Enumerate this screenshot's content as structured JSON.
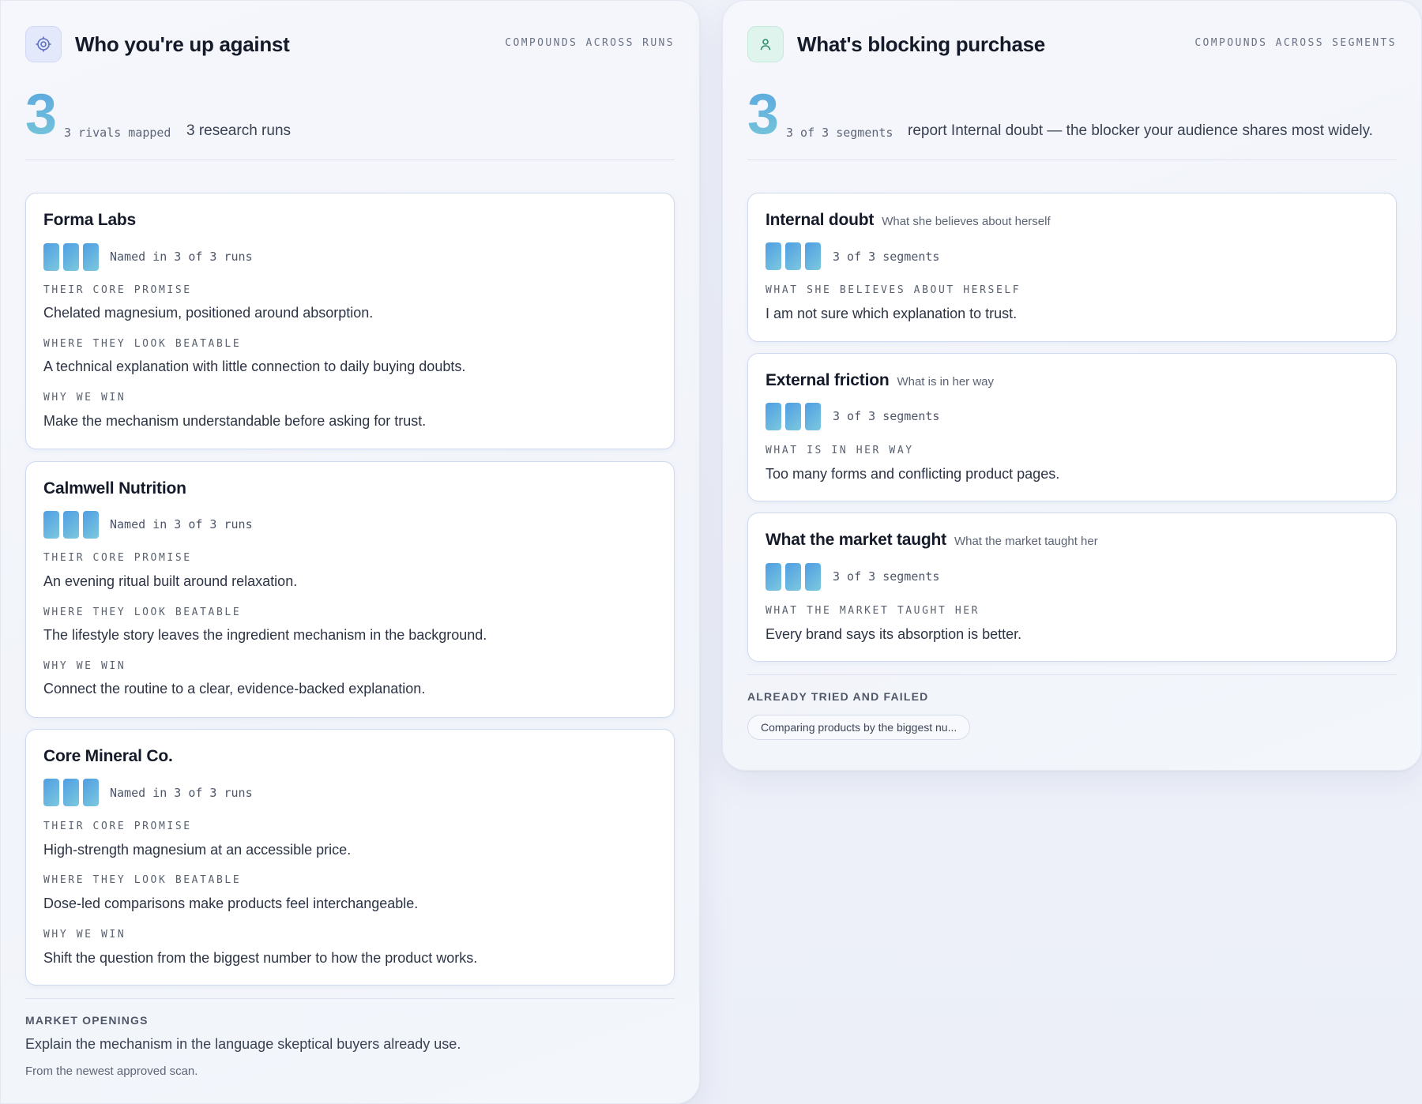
{
  "left": {
    "title": "Who you're up against",
    "tag": "COMPOUNDS ACROSS RUNS",
    "stat_number": "3",
    "stat_mono": "3 rivals mapped",
    "stat_text": "3 research runs",
    "icon": "target-icon",
    "rivals": [
      {
        "name": "Forma Labs",
        "runs_label": "Named in 3 of 3 runs",
        "runs_named": 3,
        "runs_total": 3,
        "promise_label": "THEIR CORE PROMISE",
        "promise": "Chelated magnesium, positioned around absorption.",
        "beatable_label": "WHERE THEY LOOK BEATABLE",
        "beatable": "A technical explanation with little connection to daily buying doubts.",
        "win_label": "WHY WE WIN",
        "win": "Make the mechanism understandable before asking for trust."
      },
      {
        "name": "Calmwell Nutrition",
        "runs_label": "Named in 3 of 3 runs",
        "runs_named": 3,
        "runs_total": 3,
        "promise_label": "THEIR CORE PROMISE",
        "promise": "An evening ritual built around relaxation.",
        "beatable_label": "WHERE THEY LOOK BEATABLE",
        "beatable": "The lifestyle story leaves the ingredient mechanism in the background.",
        "win_label": "WHY WE WIN",
        "win": "Connect the routine to a clear, evidence-backed explanation."
      },
      {
        "name": "Core Mineral Co.",
        "runs_label": "Named in 3 of 3 runs",
        "runs_named": 3,
        "runs_total": 3,
        "promise_label": "THEIR CORE PROMISE",
        "promise": "High-strength magnesium at an accessible price.",
        "beatable_label": "WHERE THEY LOOK BEATABLE",
        "beatable": "Dose-led comparisons make products feel interchangeable.",
        "win_label": "WHY WE WIN",
        "win": "Shift the question from the biggest number to how the product works."
      }
    ],
    "openings_label": "MARKET OPENINGS",
    "openings_text": "Explain the mechanism in the language skeptical buyers already use.",
    "openings_note": "From the newest approved scan."
  },
  "right": {
    "title": "What's blocking purchase",
    "tag": "COMPOUNDS ACROSS SEGMENTS",
    "stat_number": "3",
    "stat_mono": "3 of 3 segments",
    "stat_text": "report Internal doubt — the blocker your audience shares most widely.",
    "icon": "person-icon",
    "blockers": [
      {
        "name": "Internal doubt",
        "subtitle": "What she believes about herself",
        "segments_label": "3 of 3 segments",
        "segments_named": 3,
        "segments_total": 3,
        "quote_label": "WHAT SHE BELIEVES ABOUT HERSELF",
        "quote": "I am not sure which explanation to trust."
      },
      {
        "name": "External friction",
        "subtitle": "What is in her way",
        "segments_label": "3 of 3 segments",
        "segments_named": 3,
        "segments_total": 3,
        "quote_label": "WHAT IS IN HER WAY",
        "quote": "Too many forms and conflicting product pages."
      },
      {
        "name": "What the market taught",
        "subtitle": "What the market taught her",
        "segments_label": "3 of 3 segments",
        "segments_named": 3,
        "segments_total": 3,
        "quote_label": "WHAT THE MARKET TAUGHT HER",
        "quote": "Every brand says its absorption is better."
      }
    ],
    "tried_label": "ALREADY TRIED AND FAILED",
    "tried_chips": [
      "Comparing products by the biggest nu..."
    ]
  },
  "colors": {
    "accent_gradient_start": "#4f9ee3",
    "accent_gradient_end": "#7cc8de",
    "card_border": "#cfd9ef"
  }
}
